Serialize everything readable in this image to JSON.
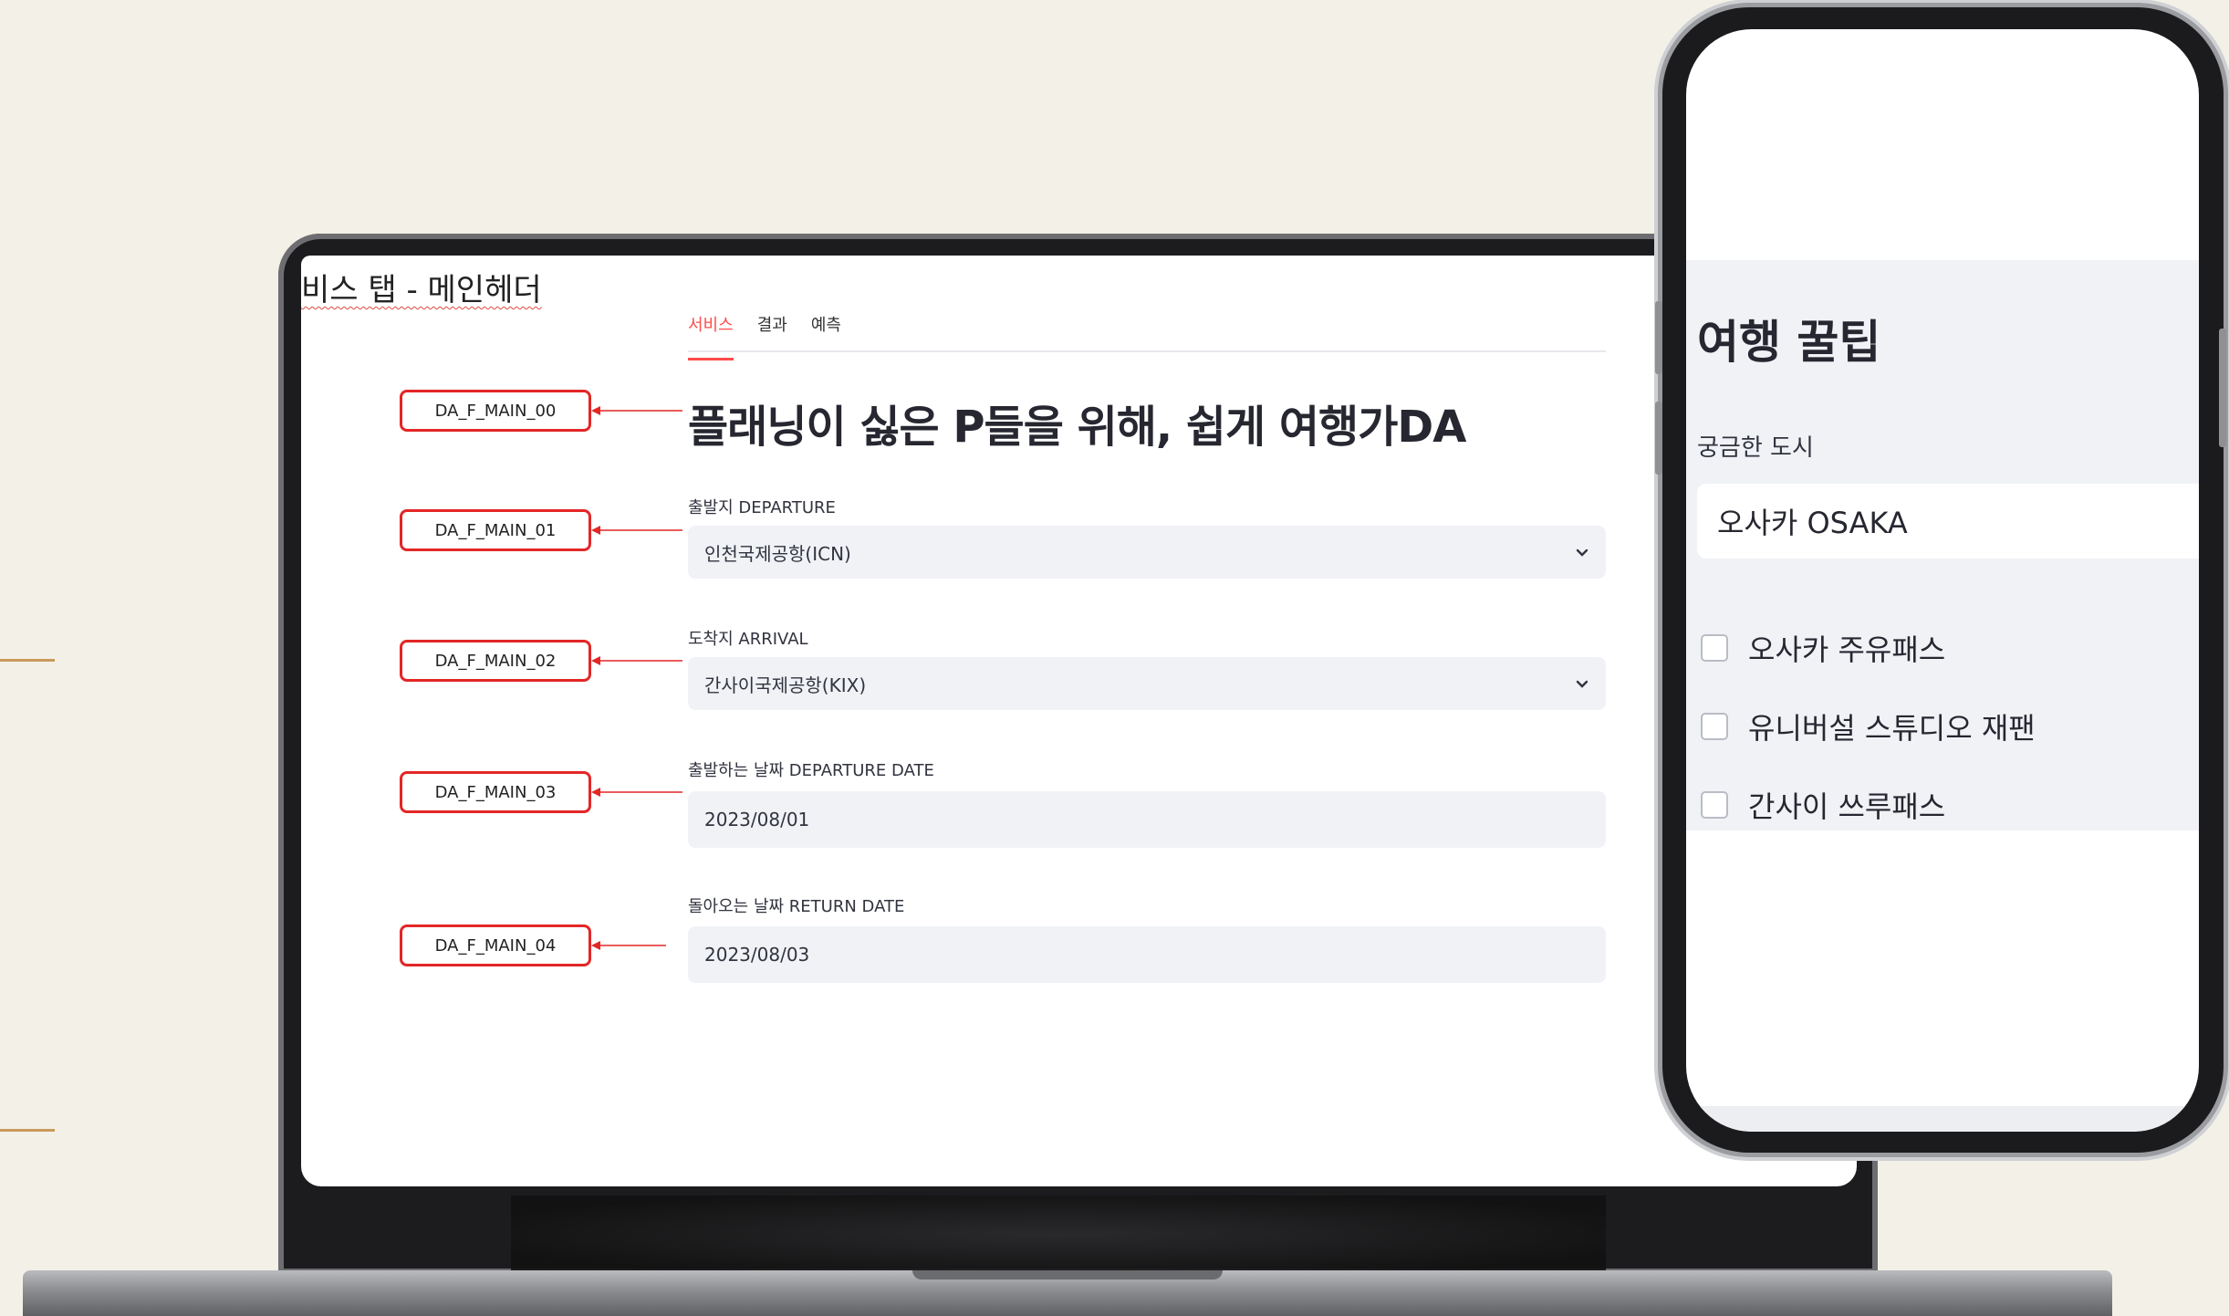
{
  "screen_heading": "비스 탭 - 메인헤더",
  "tabs": [
    {
      "label": "서비스",
      "active": true
    },
    {
      "label": "결과",
      "active": false
    },
    {
      "label": "예측",
      "active": false
    }
  ],
  "page_title": "플래닝이 싫은 P들을 위해, 쉽게 여행가DA",
  "fields": {
    "departure": {
      "label": "출발지 DEPARTURE",
      "value": "인천국제공항(ICN)"
    },
    "arrival": {
      "label": "도착지 ARRIVAL",
      "value": "간사이국제공항(KIX)"
    },
    "departure_date": {
      "label": "출발하는 날짜 DEPARTURE DATE",
      "value": "2023/08/01"
    },
    "return_date": {
      "label": "돌아오는 날짜 RETURN DATE",
      "value": "2023/08/03"
    }
  },
  "annotations": [
    "DA_F_MAIN_00",
    "DA_F_MAIN_01",
    "DA_F_MAIN_02",
    "DA_F_MAIN_03",
    "DA_F_MAIN_04"
  ],
  "phone": {
    "title": "여행 꿀팁",
    "city_label": "궁금한 도시",
    "city_value": "오사카 OSAKA",
    "options": [
      {
        "label": "오사카 주유패스",
        "checked": false
      },
      {
        "label": "유니버설 스튜디오 재팬",
        "checked": false
      },
      {
        "label": "간사이 쓰루패스",
        "checked": false
      }
    ]
  },
  "colors": {
    "accent": "#ff4b4b",
    "annotation": "#e32626",
    "background": "#f3f0e7",
    "decor_line": "#c89a5b"
  },
  "icons": [
    "chevron-down-icon",
    "arrow-left-icon",
    "checkbox-icon"
  ]
}
